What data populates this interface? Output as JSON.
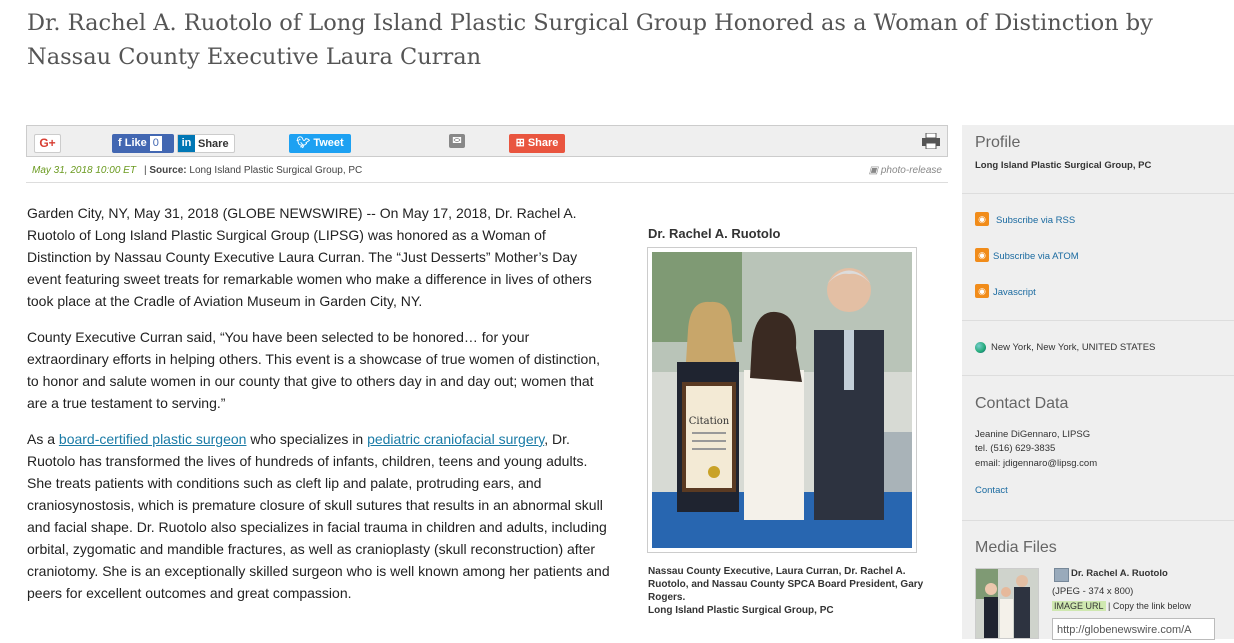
{
  "headline": "Dr. Rachel A. Ruotolo of Long Island Plastic Surgical Group Honored as a Woman of Distinction by Nassau County Executive Laura Curran",
  "toolbar": {
    "gplus": "G+",
    "fb_like": "Like",
    "fb_count": "0",
    "linkedin_share": "Share",
    "linkedin_in": "in",
    "tweet": "Tweet",
    "share": "Share"
  },
  "meta": {
    "date": "May 31, 2018 10:00 ET",
    "source_label": "Source:",
    "source": "Long Island Plastic Surgical Group, PC",
    "photo_release": "photo-release"
  },
  "article": {
    "p1": "Garden City, NY, May 31, 2018 (GLOBE NEWSWIRE) -- On May 17, 2018, Dr. Rachel A. Ruotolo of Long Island Plastic Surgical Group (LIPSG) was honored as a Woman of Distinction by Nassau County Executive Laura Curran. The “Just Desserts” Mother’s Day event featuring sweet treats for remarkable women who make a difference in lives of others took place at the Cradle of Aviation Museum in Garden City, NY.",
    "p2": "County Executive Curran said, “You have been selected to be honored… for your extraordinary efforts in helping others. This event is a showcase of true women of distinction, to honor and salute women in our county that give to others day in and day out; women that are a true testament to serving.”",
    "p3_a": "As a ",
    "p3_link1": "board-certified plastic surgeon",
    "p3_b": " who specializes in ",
    "p3_link2": "pediatric craniofacial surgery",
    "p3_c": ", Dr. Ruotolo has transformed the lives of hundreds of infants, children, teens and young adults. She treats patients with conditions such as cleft lip and palate, protruding ears, and craniosynostosis, which is premature closure of skull sutures that results in an abnormal skull and facial shape. Dr. Ruotolo also specializes in facial trauma in children and adults, including orbital, zygomatic and mandible fractures, as well as cranioplasty (skull reconstruction) after craniotomy. She is an exceptionally skilled surgeon who is well known among her patients and peers for excellent outcomes and great compassion."
  },
  "figure": {
    "title": "Dr. Rachel A. Ruotolo",
    "citation_text": "Citation",
    "caption": "Nassau County Executive, Laura Curran, Dr. Rachel A. Ruotolo, and Nassau County SPCA Board President, Gary Rogers.",
    "caption_source": "Long Island Plastic Surgical Group, PC"
  },
  "sidebar": {
    "profile_heading": "Profile",
    "profile_name": "Long Island Plastic Surgical Group, PC",
    "subscribe_rss": "Subscribe via RSS",
    "subscribe_atom": "Subscribe via ATOM",
    "javascript": "Javascript",
    "location": "New York, New York, UNITED STATES",
    "contact_heading": "Contact Data",
    "contact_name": "Jeanine DiGennaro, LIPSG",
    "contact_tel": "tel. (516) 629-3835",
    "contact_email": "email: jdigennaro@lipsg.com",
    "contact_link": "Contact",
    "media_heading": "Media Files",
    "media_title": "Dr. Rachel A. Ruotolo",
    "media_info": "(JPEG - 374 x 800)",
    "image_url_tag": "IMAGE URL",
    "image_url_hint": " | Copy the link below",
    "image_url_value": "http://globenewswire.com/A"
  },
  "colors": {
    "link": "#1a7ba6",
    "facebook": "#4267b2",
    "twitter": "#1da1f2",
    "share": "#e9553f",
    "rss": "#f18c1a",
    "date": "#6a9a1f"
  }
}
